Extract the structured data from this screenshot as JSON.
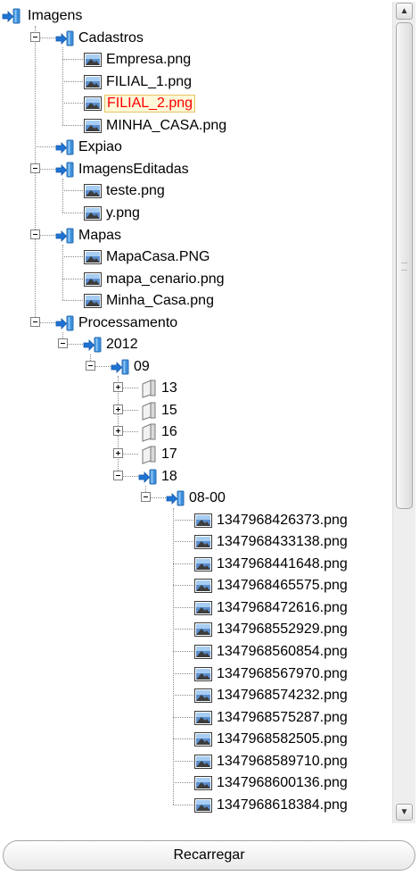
{
  "tree": [
    {
      "label": "Imagens",
      "kind": "folder-open",
      "depth": 0,
      "toggle": "none",
      "hasChildren": true,
      "last": true
    },
    {
      "label": "Cadastros",
      "kind": "folder-open",
      "depth": 1,
      "toggle": "minus",
      "hasChildren": true,
      "last": false
    },
    {
      "label": "Empresa.png",
      "kind": "image",
      "depth": 2,
      "toggle": "none",
      "hasChildren": false,
      "last": false
    },
    {
      "label": "FILIAL_1.png",
      "kind": "image",
      "depth": 2,
      "toggle": "none",
      "hasChildren": false,
      "last": false
    },
    {
      "label": "FILIAL_2.png",
      "kind": "image",
      "depth": 2,
      "toggle": "none",
      "hasChildren": false,
      "last": false,
      "selected": true
    },
    {
      "label": "MINHA_CASA.png",
      "kind": "image",
      "depth": 2,
      "toggle": "none",
      "hasChildren": false,
      "last": true
    },
    {
      "label": "Expiao",
      "kind": "folder-open",
      "depth": 1,
      "toggle": "none",
      "hasChildren": false,
      "last": false
    },
    {
      "label": "ImagensEditadas",
      "kind": "folder-open",
      "depth": 1,
      "toggle": "minus",
      "hasChildren": true,
      "last": false
    },
    {
      "label": "teste.png",
      "kind": "image",
      "depth": 2,
      "toggle": "none",
      "hasChildren": false,
      "last": false
    },
    {
      "label": "y.png",
      "kind": "image",
      "depth": 2,
      "toggle": "none",
      "hasChildren": false,
      "last": true
    },
    {
      "label": "Mapas",
      "kind": "folder-open",
      "depth": 1,
      "toggle": "minus",
      "hasChildren": true,
      "last": false
    },
    {
      "label": "MapaCasa.PNG",
      "kind": "image",
      "depth": 2,
      "toggle": "none",
      "hasChildren": false,
      "last": false
    },
    {
      "label": "mapa_cenario.png",
      "kind": "image",
      "depth": 2,
      "toggle": "none",
      "hasChildren": false,
      "last": false
    },
    {
      "label": "Minha_Casa.png",
      "kind": "image",
      "depth": 2,
      "toggle": "none",
      "hasChildren": false,
      "last": true
    },
    {
      "label": "Processamento",
      "kind": "folder-open",
      "depth": 1,
      "toggle": "minus",
      "hasChildren": true,
      "last": true
    },
    {
      "label": "2012",
      "kind": "folder-open",
      "depth": 2,
      "toggle": "minus",
      "hasChildren": true,
      "last": true
    },
    {
      "label": "09",
      "kind": "folder-open",
      "depth": 3,
      "toggle": "minus",
      "hasChildren": true,
      "last": true
    },
    {
      "label": "13",
      "kind": "folder-closed",
      "depth": 4,
      "toggle": "plus",
      "hasChildren": false,
      "last": false
    },
    {
      "label": "15",
      "kind": "folder-closed",
      "depth": 4,
      "toggle": "plus",
      "hasChildren": false,
      "last": false
    },
    {
      "label": "16",
      "kind": "folder-closed",
      "depth": 4,
      "toggle": "plus",
      "hasChildren": false,
      "last": false
    },
    {
      "label": "17",
      "kind": "folder-closed",
      "depth": 4,
      "toggle": "plus",
      "hasChildren": false,
      "last": false
    },
    {
      "label": "18",
      "kind": "folder-open",
      "depth": 4,
      "toggle": "minus",
      "hasChildren": true,
      "last": true
    },
    {
      "label": "08-00",
      "kind": "folder-open",
      "depth": 5,
      "toggle": "minus",
      "hasChildren": true,
      "last": true
    },
    {
      "label": "1347968426373.png",
      "kind": "image",
      "depth": 6,
      "toggle": "none",
      "hasChildren": false,
      "last": false
    },
    {
      "label": "1347968433138.png",
      "kind": "image",
      "depth": 6,
      "toggle": "none",
      "hasChildren": false,
      "last": false
    },
    {
      "label": "1347968441648.png",
      "kind": "image",
      "depth": 6,
      "toggle": "none",
      "hasChildren": false,
      "last": false
    },
    {
      "label": "1347968465575.png",
      "kind": "image",
      "depth": 6,
      "toggle": "none",
      "hasChildren": false,
      "last": false
    },
    {
      "label": "1347968472616.png",
      "kind": "image",
      "depth": 6,
      "toggle": "none",
      "hasChildren": false,
      "last": false
    },
    {
      "label": "1347968552929.png",
      "kind": "image",
      "depth": 6,
      "toggle": "none",
      "hasChildren": false,
      "last": false
    },
    {
      "label": "1347968560854.png",
      "kind": "image",
      "depth": 6,
      "toggle": "none",
      "hasChildren": false,
      "last": false
    },
    {
      "label": "1347968567970.png",
      "kind": "image",
      "depth": 6,
      "toggle": "none",
      "hasChildren": false,
      "last": false
    },
    {
      "label": "1347968574232.png",
      "kind": "image",
      "depth": 6,
      "toggle": "none",
      "hasChildren": false,
      "last": false
    },
    {
      "label": "1347968575287.png",
      "kind": "image",
      "depth": 6,
      "toggle": "none",
      "hasChildren": false,
      "last": false
    },
    {
      "label": "1347968582505.png",
      "kind": "image",
      "depth": 6,
      "toggle": "none",
      "hasChildren": false,
      "last": false
    },
    {
      "label": "1347968589710.png",
      "kind": "image",
      "depth": 6,
      "toggle": "none",
      "hasChildren": false,
      "last": false
    },
    {
      "label": "1347968600136.png",
      "kind": "image",
      "depth": 6,
      "toggle": "none",
      "hasChildren": false,
      "last": false
    },
    {
      "label": "1347968618384.png",
      "kind": "image",
      "depth": 6,
      "toggle": "none",
      "hasChildren": false,
      "last": false
    }
  ],
  "scrollbar": {
    "up_icon": "chevron-up-icon",
    "down_icon": "chevron-down-icon",
    "up_glyph": "▲",
    "down_glyph": "▼",
    "position_fraction": 0.0,
    "visible_fraction": 0.6
  },
  "reload_button": {
    "label": "Recarregar"
  },
  "colors": {
    "selected_text": "#ff0000",
    "selected_bg": "#fff8d8",
    "selected_border": "#e5c365",
    "folder_blue": "#3d8fdc",
    "arrow_blue": "#1f73d4"
  }
}
